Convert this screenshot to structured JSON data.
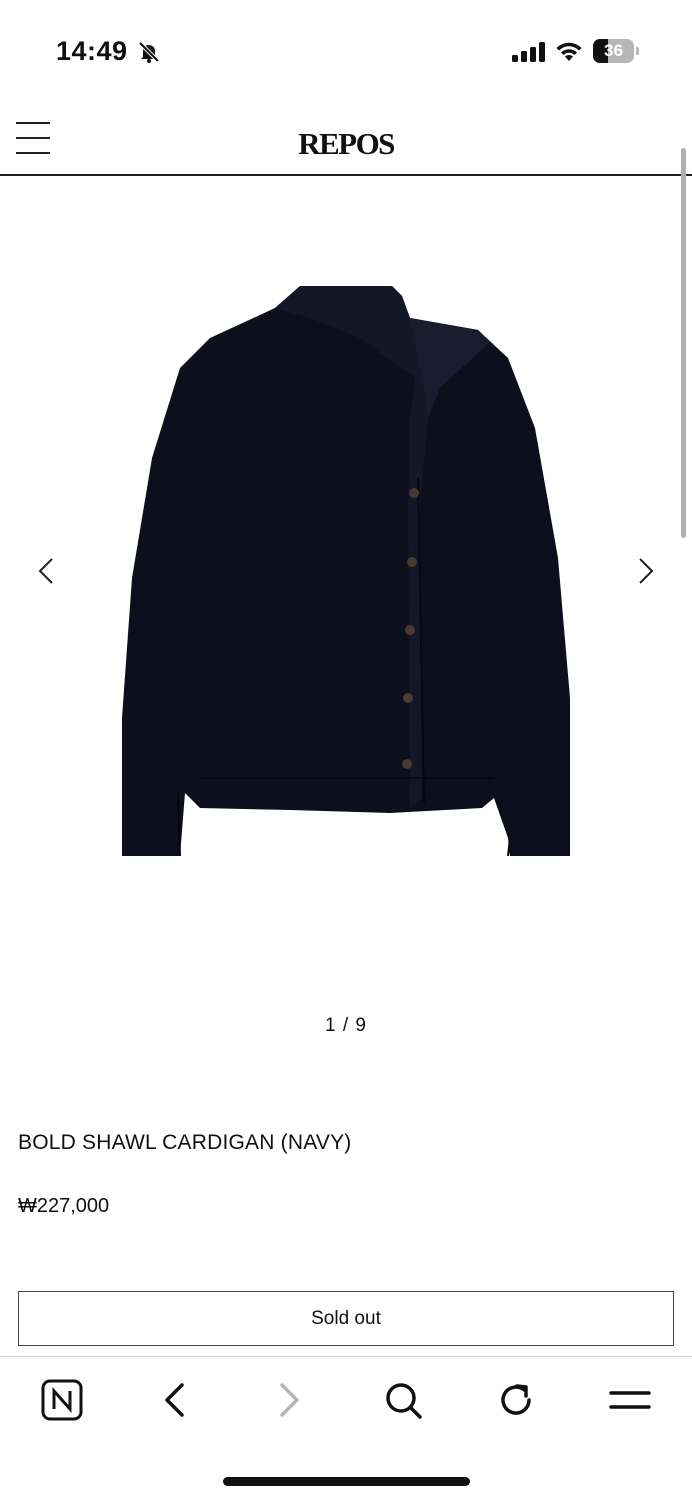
{
  "status_bar": {
    "time": "14:49",
    "battery_level": "36",
    "battery_fraction": 0.36,
    "icons": [
      "bell-slash-icon",
      "cellular-signal-icon",
      "wifi-icon",
      "battery-icon"
    ]
  },
  "header": {
    "logo": "REPOS",
    "menu_icon": "hamburger-menu-icon"
  },
  "gallery": {
    "pager": "1 / 9",
    "image_alt": "BOLD SHAWL CARDIGAN (NAVY)",
    "prev_icon": "chevron-left-icon",
    "next_icon": "chevron-right-icon"
  },
  "product": {
    "name": "BOLD SHAWL CARDIGAN (NAVY)",
    "price": "₩227,000",
    "button_label": "Sold out"
  },
  "browser_toolbar": {
    "items": [
      "naver-logo-icon",
      "back-arrow-icon",
      "forward-arrow-icon",
      "search-icon",
      "refresh-icon",
      "menu-icon"
    ]
  },
  "colors": {
    "garment": "#0d0f1c",
    "text": "#111111",
    "button_border": "#444444",
    "disabled_arrow": "#b5b5b5"
  }
}
